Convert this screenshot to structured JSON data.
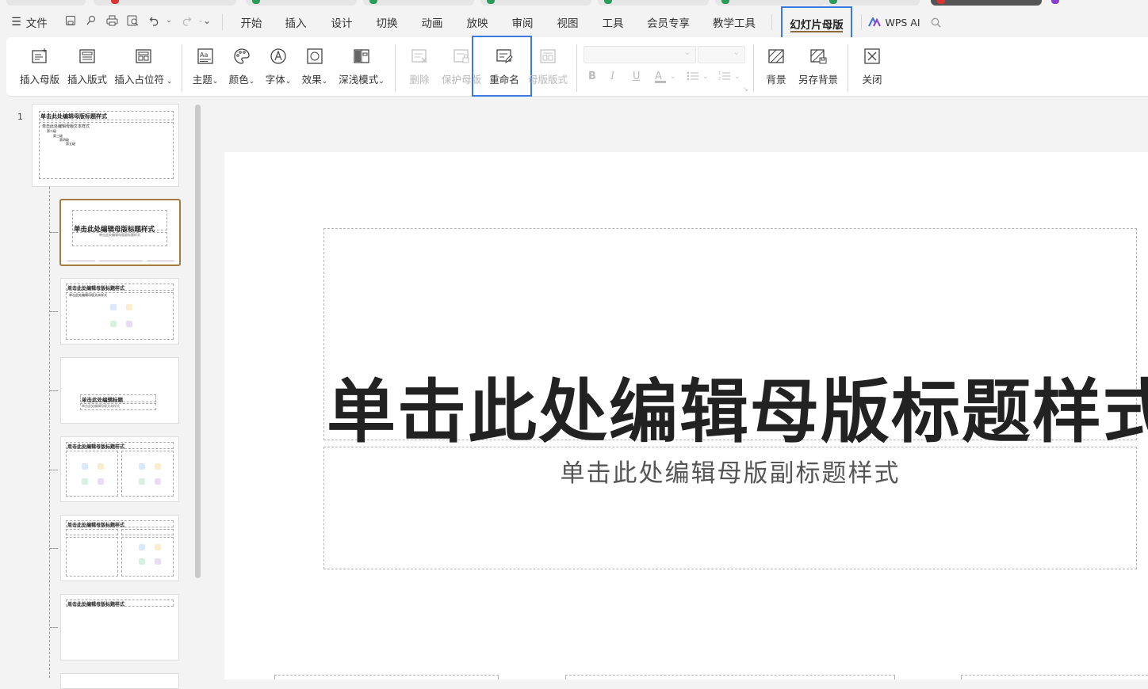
{
  "menu": {
    "file": "文件",
    "tabs": [
      "开始",
      "插入",
      "设计",
      "切换",
      "动画",
      "放映",
      "审阅",
      "视图",
      "工具",
      "会员专享",
      "教学工具"
    ],
    "active_tab": "幻灯片母版",
    "ai": "WPS AI"
  },
  "ribbon": {
    "insert_master": "插入母版",
    "insert_layout": "插入版式",
    "insert_placeholder": "插入占位符",
    "theme": "主题",
    "colors": "颜色",
    "fonts": "字体",
    "effects": "效果",
    "depth_mode": "深浅模式",
    "delete": "删除",
    "protect_master": "保护母版",
    "rename": "重命名",
    "master_layout": "母版版式",
    "background": "背景",
    "save_background": "另存背景",
    "close": "关闭"
  },
  "thumbnails": {
    "slide_number": "1",
    "master_title": "单击此处编辑母版标题样式",
    "master_text": "单击此处编辑母版文本样式",
    "level2": "第二级",
    "level3": "第三级",
    "level4": "第四级",
    "level5": "第五级",
    "layout2_sub": "单击此处编辑母版副标题样式",
    "section_title": "单击此处编辑标题"
  },
  "slide": {
    "title": "单击此处编辑母版标题样式",
    "subtitle": "单击此处编辑母版副标题样式"
  },
  "colors": {
    "highlight": "#3b7be0",
    "selected_border": "#a57b3f"
  }
}
